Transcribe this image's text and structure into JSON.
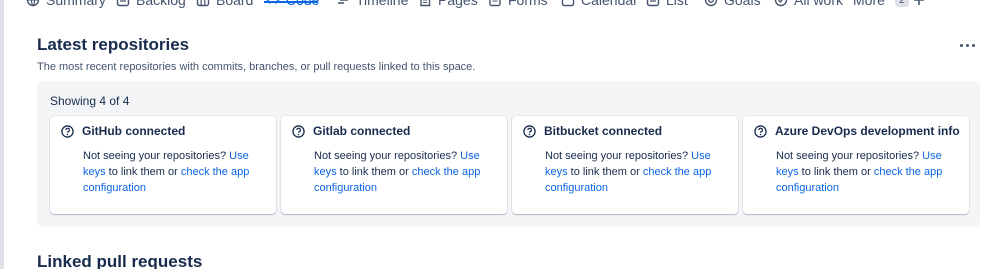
{
  "nav": {
    "items": [
      {
        "label": "Summary",
        "icon": "globe-icon"
      },
      {
        "label": "Backlog",
        "icon": "backlog-icon"
      },
      {
        "label": "Board",
        "icon": "board-icon"
      },
      {
        "label": "Code",
        "icon": "code-icon"
      },
      {
        "label": "Timeline",
        "icon": "timeline-icon"
      },
      {
        "label": "Pages",
        "icon": "pages-icon"
      },
      {
        "label": "Forms",
        "icon": "forms-icon"
      },
      {
        "label": "Calendar",
        "icon": "calendar-icon"
      },
      {
        "label": "List",
        "icon": "list-icon"
      },
      {
        "label": "Goals",
        "icon": "goals-icon"
      },
      {
        "label": "All work",
        "icon": "all-work-icon"
      }
    ],
    "more_label": "More",
    "more_count": "2",
    "add_icon": "plus-icon",
    "active": "Code",
    "accent_color": "#0c66e4"
  },
  "section": {
    "title": "Latest repositories",
    "subtitle": "The most recent repositories with commits, branches, or pull requests linked to this space.",
    "menu_icon": "more-options-icon",
    "showing": "Showing 4 of 4",
    "cards": [
      {
        "title": "GitHub connected",
        "text_before": "Not seeing your repositories? ",
        "link1": "Use keys",
        "text_mid": " to link them or ",
        "link2": "check the app configuration"
      },
      {
        "title": "Gitlab connected",
        "text_before": "Not seeing your repositories? ",
        "link1": "Use keys",
        "text_mid": " to link them or ",
        "link2": "check the app configuration"
      },
      {
        "title": "Bitbucket connected",
        "text_before": "Not seeing your repositories? ",
        "link1": "Use keys",
        "text_mid": " to link them or ",
        "link2": "check the app configuration"
      },
      {
        "title": "Azure DevOps development info",
        "text_before": "Not seeing your repositories? ",
        "link1": "Use keys",
        "text_mid": " to link them or ",
        "link2": "check the app configuration"
      }
    ]
  },
  "section2": {
    "title": "Linked pull requests"
  }
}
